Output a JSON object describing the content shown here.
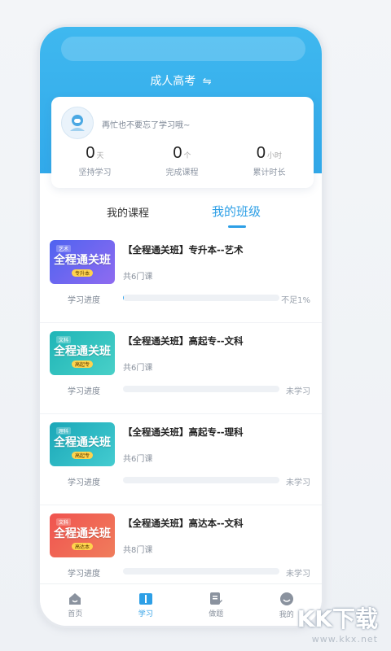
{
  "header": {
    "title": "成人高考",
    "swap_glyph": "⇋"
  },
  "stats": {
    "tip": "再忙也不要忘了学习哦~",
    "items": [
      {
        "value": "0",
        "unit": "天",
        "label": "坚持学习"
      },
      {
        "value": "0",
        "unit": "个",
        "label": "完成课程"
      },
      {
        "value": "0",
        "unit": "小时",
        "label": "累计时长"
      }
    ]
  },
  "tabs": {
    "my_courses": "我的课程",
    "my_classes": "我的班级",
    "active": "my_classes"
  },
  "courses": [
    {
      "title": "【全程通关班】专升本--艺术",
      "count": "共6门课",
      "progress_label": "学习进度",
      "status": "不足1%",
      "progress": 0.005,
      "thumb": {
        "tag": "艺术",
        "big": "全程通关班",
        "small": "专升本",
        "color1": "#4f63f0",
        "color2": "#8f6bf0"
      }
    },
    {
      "title": "【全程通关班】高起专--文科",
      "count": "共6门课",
      "progress_label": "学习进度",
      "status": "未学习",
      "progress": 0,
      "thumb": {
        "tag": "文科",
        "big": "全程通关班",
        "small": "高起专",
        "color1": "#1fb5b7",
        "color2": "#49d0c8"
      }
    },
    {
      "title": "【全程通关班】高起专--理科",
      "count": "共6门课",
      "progress_label": "学习进度",
      "status": "未学习",
      "progress": 0,
      "thumb": {
        "tag": "理科",
        "big": "全程通关班",
        "small": "高起专",
        "color1": "#1aa7b8",
        "color2": "#44ccd0"
      }
    },
    {
      "title": "【全程通关班】高达本--文科",
      "count": "共8门课",
      "progress_label": "学习进度",
      "status": "未学习",
      "progress": 0,
      "thumb": {
        "tag": "文科",
        "big": "全程通关班",
        "small": "高达本",
        "color1": "#f0534f",
        "color2": "#f07d5c"
      }
    }
  ],
  "tabbar": [
    {
      "label": "首页",
      "icon": "home-icon",
      "active": false
    },
    {
      "label": "学习",
      "icon": "book-icon",
      "active": true
    },
    {
      "label": "做题",
      "icon": "edit-icon",
      "active": false
    },
    {
      "label": "我的",
      "icon": "user-face-icon",
      "active": false
    }
  ],
  "watermark": {
    "main": "KK下载",
    "url": "www.kkx.net"
  },
  "colors": {
    "accent": "#2d9fe6",
    "header": "#3fb8ef"
  }
}
